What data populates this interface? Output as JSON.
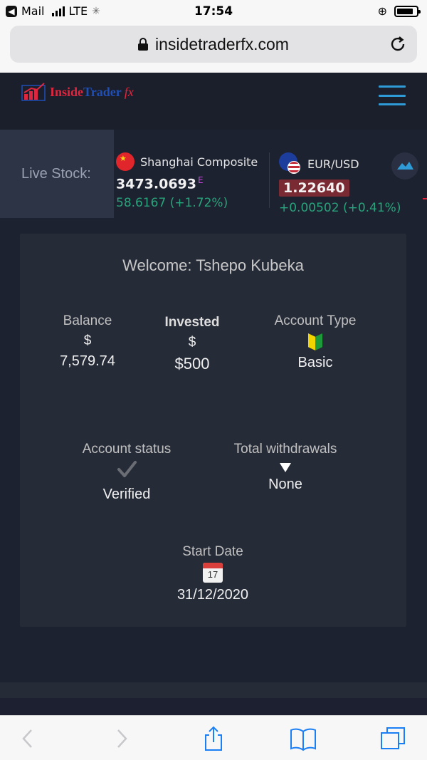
{
  "status_bar": {
    "carrier": "Mail",
    "network": "LTE",
    "time": "17:54"
  },
  "browser": {
    "url": "insidetraderfx.com"
  },
  "site": {
    "logo_part1": "Inside",
    "logo_part2": "Trader",
    "logo_fx": "fx"
  },
  "ticker": {
    "label": "Live Stock:",
    "items": [
      {
        "name": "Shanghai Composite",
        "price": "3473.0693",
        "flag": "E",
        "change": "58.6167 (+1.72%)"
      },
      {
        "name": "EUR/USD",
        "price": "1.22640",
        "change": "+0.00502 (+0.41%)"
      }
    ]
  },
  "dashboard": {
    "welcome": "Welcome: Tshepo Kubeka",
    "balance": {
      "label": "Balance",
      "currency": "$",
      "value": "7,579.74"
    },
    "invested": {
      "label": "Invested",
      "currency": "$",
      "value": "$500"
    },
    "account_type": {
      "label": "Account Type",
      "value": "Basic"
    },
    "account_status": {
      "label": "Account status",
      "value": "Verified"
    },
    "total_withdrawals": {
      "label": "Total withdrawals",
      "value": "None"
    },
    "start_date": {
      "label": "Start Date",
      "calendar_day": "17",
      "value": "31/12/2020"
    }
  },
  "colors": {
    "page_bg": "#1d2230",
    "card_bg": "#262b38",
    "accent_blue": "#2e9bd6",
    "positive_green": "#29a37b"
  }
}
